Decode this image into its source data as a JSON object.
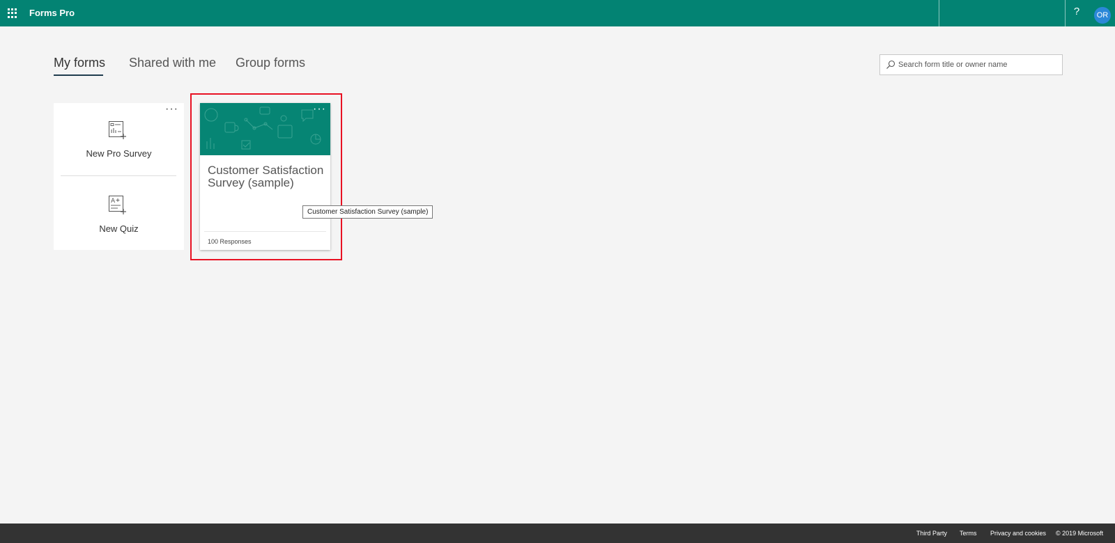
{
  "colors": {
    "brand": "#038373",
    "highlight": "#e81123",
    "avatar_bg": "#2b88d8",
    "footer_bg": "#333333"
  },
  "topbar": {
    "app_title": "Forms Pro",
    "help": "?",
    "avatar_initials": "OR",
    "icons": [
      "app-launcher-icon",
      "help-icon"
    ]
  },
  "tabs": [
    {
      "label": "My forms",
      "active": true
    },
    {
      "label": "Shared with me",
      "active": false
    },
    {
      "label": "Group forms",
      "active": false
    }
  ],
  "search": {
    "placeholder": "Search form title or owner name",
    "value": ""
  },
  "new_card": {
    "more": "···",
    "items": [
      {
        "label": "New Pro Survey",
        "icon": "new-survey-icon"
      },
      {
        "label": "New Quiz",
        "icon": "new-quiz-icon"
      }
    ]
  },
  "form_card": {
    "title": "Customer Satisfaction Survey (sample)",
    "responses": "100 Responses",
    "more": "···"
  },
  "tooltip": {
    "text": "Customer Satisfaction Survey (sample)"
  },
  "footer": {
    "links": [
      "Third Party",
      "Terms",
      "Privacy and cookies",
      "© 2019 Microsoft"
    ]
  }
}
